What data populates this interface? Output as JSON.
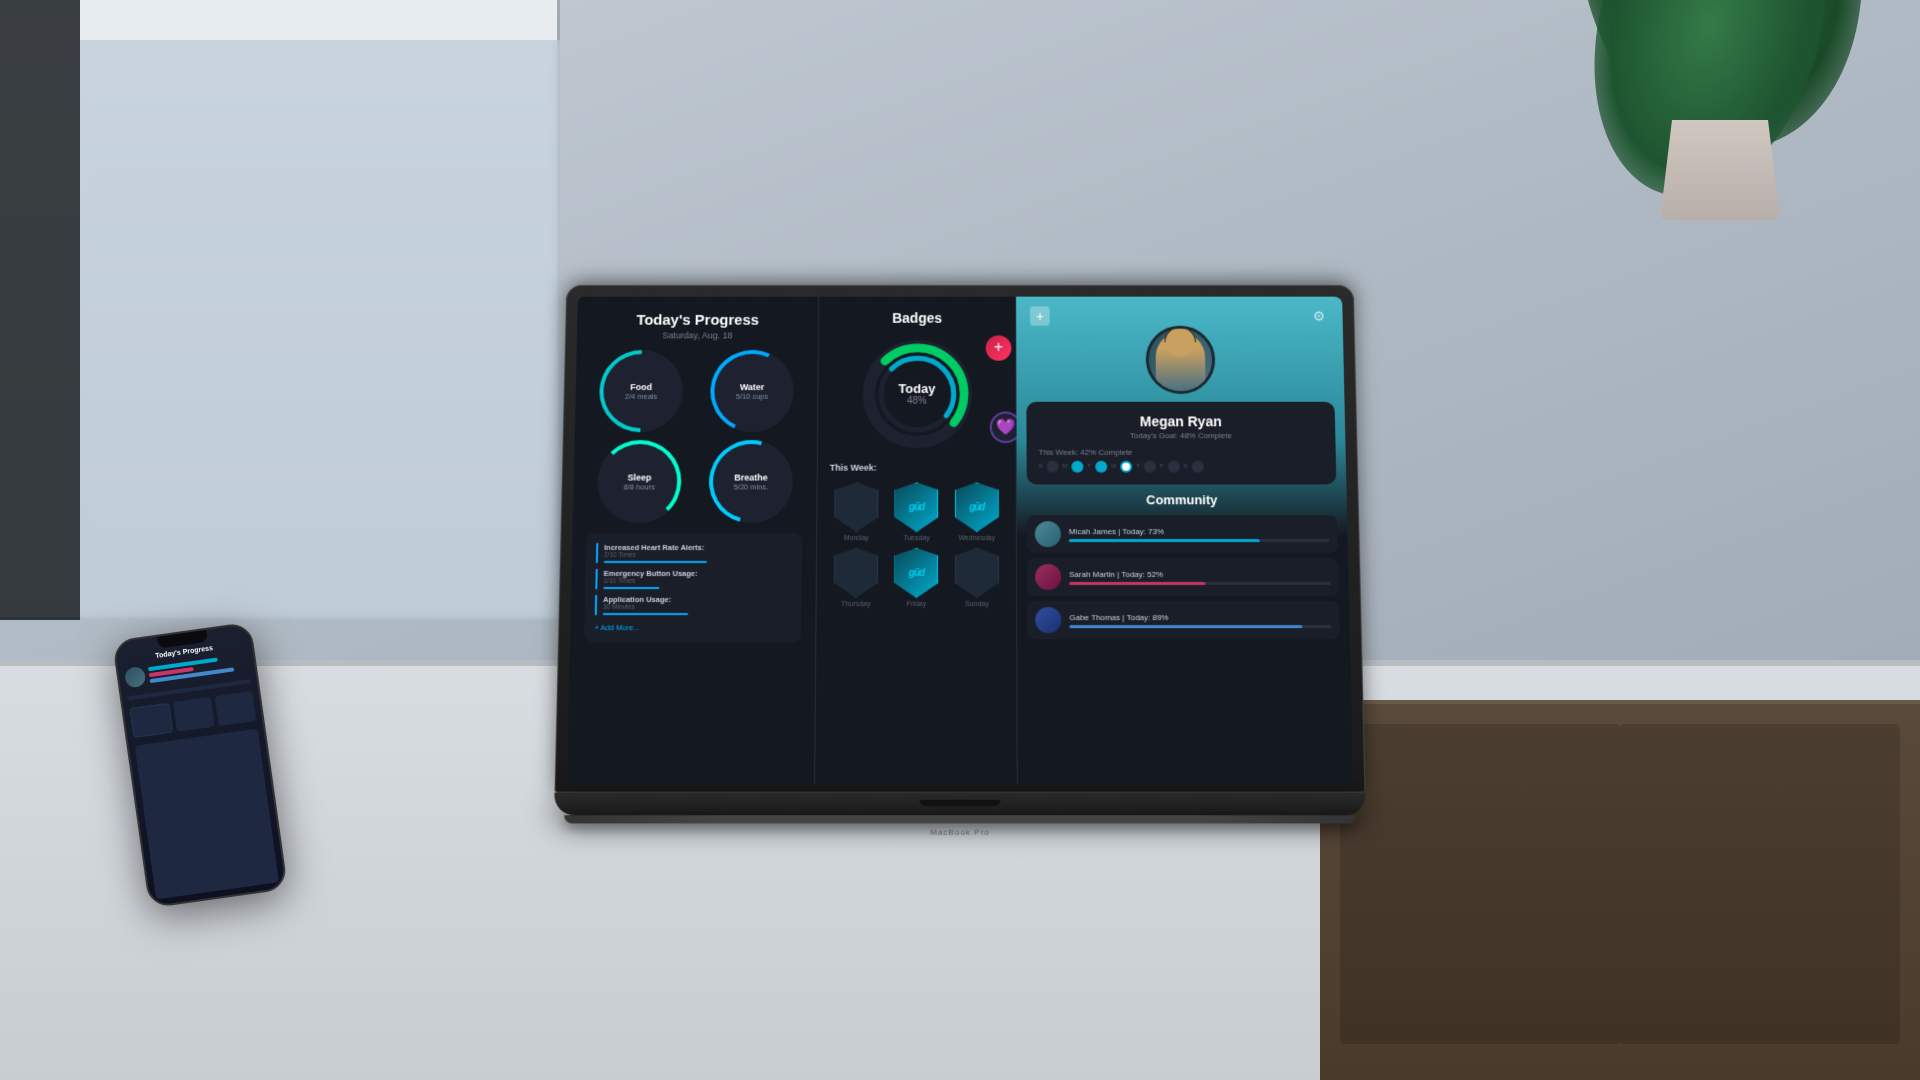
{
  "scene": {
    "bg_color": "#b8bfc8"
  },
  "app": {
    "left_panel": {
      "title": "Today's Progress",
      "subtitle": "Saturday, Aug. 18",
      "metrics": [
        {
          "label": "Food",
          "value": "2/4 meals",
          "color": "#00cccc"
        },
        {
          "label": "Water",
          "value": "5/10 cups",
          "color": "#00aaff"
        },
        {
          "label": "Sleep",
          "value": "8/8 hours",
          "color": "#00ffcc"
        },
        {
          "label": "Breathe",
          "value": "5/20 mins.",
          "color": "#00ccff"
        }
      ],
      "alerts": [
        {
          "title": "Increased Heart Rate Alerts:",
          "sub": "2/10 Times",
          "bar_width": "55%",
          "bar_color": "#00aaff"
        },
        {
          "title": "Emergency Button Usage:",
          "sub": "1/10 Times",
          "bar_width": "30%",
          "bar_color": "#00aaff"
        },
        {
          "title": "Application Usage:",
          "sub": "30 Minutes",
          "bar_width": "45%",
          "bar_color": "#00aaff"
        }
      ],
      "add_more_label": "+ Add More..."
    },
    "mid_panel": {
      "title": "Badges",
      "today": {
        "label": "Today",
        "percent": 48,
        "percent_label": "48%"
      },
      "this_week_label": "This Week:",
      "week_badges": [
        {
          "day": "Monday",
          "active": false
        },
        {
          "day": "Tuesday",
          "active": true
        },
        {
          "day": "Wednesday",
          "active": true
        },
        {
          "day": "Thursday",
          "active": false
        },
        {
          "day": "Friday",
          "active": true
        },
        {
          "day": "Sunday",
          "active": false
        }
      ]
    },
    "right_panel": {
      "plus_label": "+",
      "gear_label": "⚙",
      "profile": {
        "name": "Megan Ryan",
        "goal": "Today's Goal: 48% Complete",
        "week_label": "This Week: 42% Complete",
        "week_days": [
          "S",
          "M",
          "T",
          "W",
          "T",
          "F",
          "S"
        ],
        "active_days": [
          1,
          2,
          3
        ]
      },
      "community": {
        "title": "Community",
        "members": [
          {
            "name": "Micah James | Today: 73%",
            "bar_width": "73%",
            "bar_color": "#00aacc",
            "av_color": "#4a7a8a"
          },
          {
            "name": "Sarah Martin | Today: 52%",
            "bar_width": "52%",
            "bar_color": "#cc3366",
            "av_color": "#8a3050"
          },
          {
            "name": "Gabe Thomas | Today: 89%",
            "bar_width": "89%",
            "bar_color": "#4488cc",
            "av_color": "#334488"
          }
        ]
      }
    }
  },
  "macbook_label": "MacBook Pro"
}
